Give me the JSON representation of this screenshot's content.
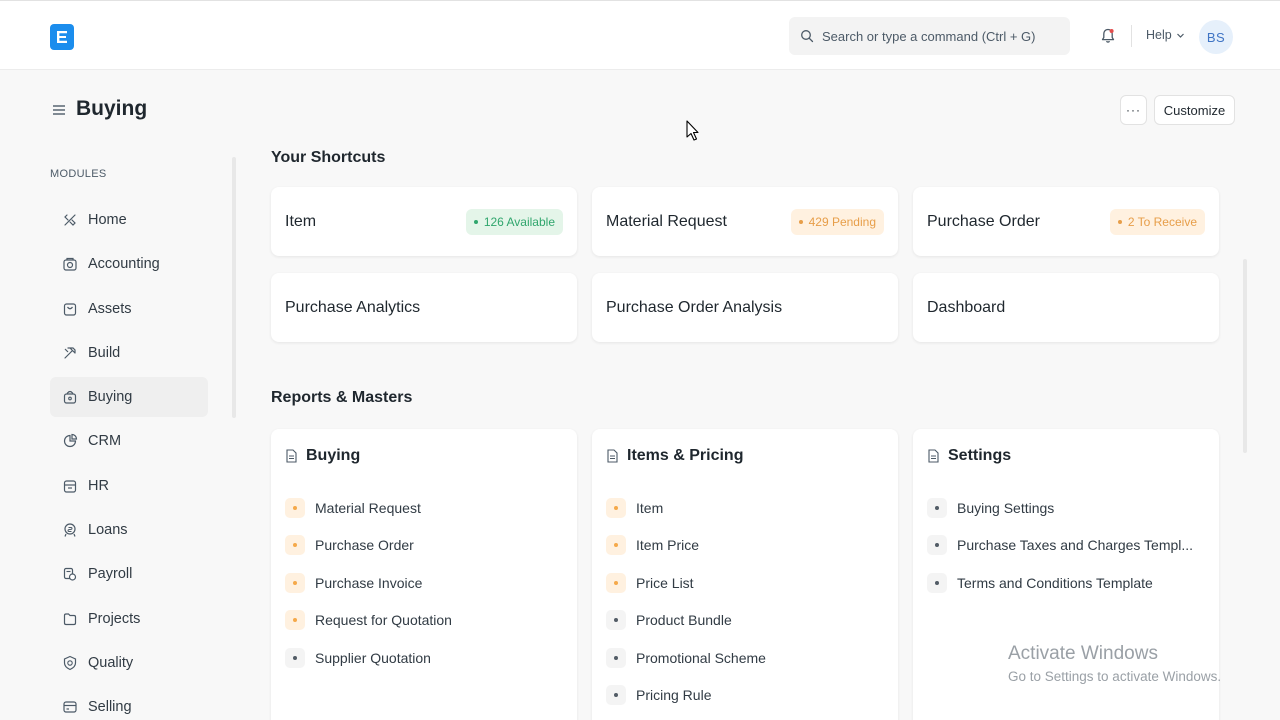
{
  "navbar": {
    "search_placeholder": "Search or type a command (Ctrl + G)",
    "help_label": "Help",
    "avatar_initials": "BS"
  },
  "page": {
    "title": "Buying",
    "more_label": "···",
    "customize_label": "Customize"
  },
  "sidebar": {
    "heading": "MODULES",
    "items": [
      {
        "label": "Home",
        "icon": "home-icon"
      },
      {
        "label": "Accounting",
        "icon": "accounting-icon"
      },
      {
        "label": "Assets",
        "icon": "assets-icon"
      },
      {
        "label": "Build",
        "icon": "build-icon"
      },
      {
        "label": "Buying",
        "icon": "buying-icon",
        "active": true
      },
      {
        "label": "CRM",
        "icon": "crm-icon"
      },
      {
        "label": "HR",
        "icon": "hr-icon"
      },
      {
        "label": "Loans",
        "icon": "loans-icon"
      },
      {
        "label": "Payroll",
        "icon": "payroll-icon"
      },
      {
        "label": "Projects",
        "icon": "projects-icon"
      },
      {
        "label": "Quality",
        "icon": "quality-icon"
      },
      {
        "label": "Selling",
        "icon": "selling-icon"
      }
    ]
  },
  "shortcuts": {
    "title": "Your Shortcuts",
    "items": [
      {
        "label": "Item",
        "badge": "126 Available",
        "badge_color": "#30a66d"
      },
      {
        "label": "Material Request",
        "badge": "429 Pending",
        "badge_color": "#e79e49"
      },
      {
        "label": "Purchase Order",
        "badge": "2 To Receive",
        "badge_color": "#e79e49"
      },
      {
        "label": "Purchase Analytics"
      },
      {
        "label": "Purchase Order Analysis"
      },
      {
        "label": "Dashboard"
      }
    ]
  },
  "reports": {
    "title": "Reports & Masters",
    "cards": [
      {
        "title": "Buying",
        "links": [
          {
            "label": "Material Request",
            "style": "orange"
          },
          {
            "label": "Purchase Order",
            "style": "orange"
          },
          {
            "label": "Purchase Invoice",
            "style": "orange"
          },
          {
            "label": "Request for Quotation",
            "style": "orange"
          },
          {
            "label": "Supplier Quotation",
            "style": "gray"
          }
        ]
      },
      {
        "title": "Items & Pricing",
        "links": [
          {
            "label": "Item",
            "style": "orange"
          },
          {
            "label": "Item Price",
            "style": "orange"
          },
          {
            "label": "Price List",
            "style": "orange"
          },
          {
            "label": "Product Bundle",
            "style": "gray"
          },
          {
            "label": "Promotional Scheme",
            "style": "gray"
          },
          {
            "label": "Pricing Rule",
            "style": "gray"
          }
        ]
      },
      {
        "title": "Settings",
        "links": [
          {
            "label": "Buying Settings",
            "style": "gray"
          },
          {
            "label": "Purchase Taxes and Charges Templ...",
            "style": "gray"
          },
          {
            "label": "Terms and Conditions Template",
            "style": "gray"
          }
        ]
      }
    ]
  },
  "watermark": {
    "line1": "Activate Windows",
    "line2": "Go to Settings to activate Windows."
  },
  "colors": {
    "brand": "#1b8ded",
    "active_bg": "#efefef",
    "success": "#30a66d",
    "warning": "#e79e49"
  }
}
